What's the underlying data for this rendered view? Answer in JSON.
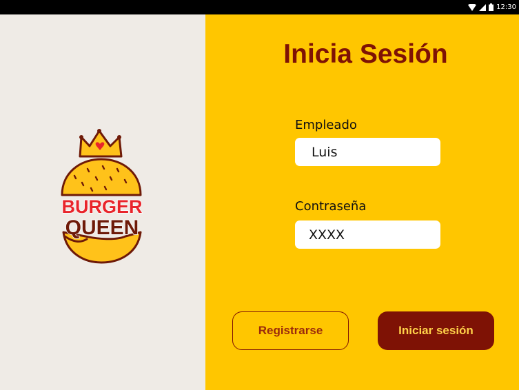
{
  "status_bar": {
    "time": "12:30",
    "icons": [
      "wifi-icon",
      "signal-icon",
      "battery-icon"
    ]
  },
  "logo": {
    "line1": "BURGER",
    "line2": "QUEEN",
    "icon": "burger-crown-logo"
  },
  "login": {
    "title": "Inicia Sesión",
    "employee_label": "Empleado",
    "employee_value": "Luis",
    "password_label": "Contraseña",
    "password_value": "XXXX",
    "register_label": "Registrarse",
    "login_label": "Iniciar sesión"
  },
  "colors": {
    "left_background": "#efebe6",
    "right_background": "#ffc600",
    "brand_dark_red": "#7e1205",
    "logo_red": "#e8252b",
    "logo_yellow": "#ffc21a"
  }
}
